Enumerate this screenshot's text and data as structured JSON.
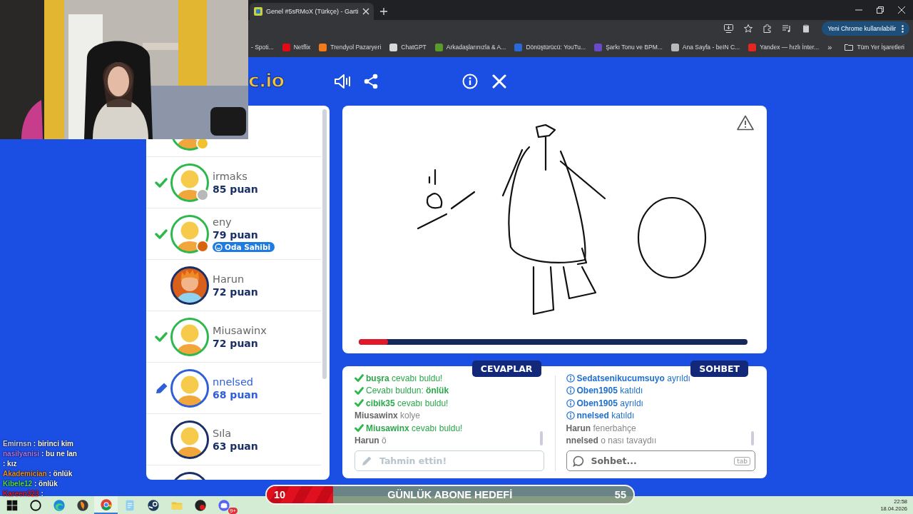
{
  "browser": {
    "tab": {
      "title": "Genel #5sRMoX (Türkçe) - Garti",
      "selected": true
    },
    "update_button": "Yeni Chrome kullanılabilir",
    "bookmarks": [
      {
        "label": "- Spoti..."
      },
      {
        "label": "Netflix",
        "color": "#e50914"
      },
      {
        "label": "Trendyol Pazaryeri",
        "color": "#f27a1a"
      },
      {
        "label": "ChatGPT",
        "color": "#d8d8d8"
      },
      {
        "label": "Arkadaşlarınızla & A...",
        "color": "#5a9a2a"
      },
      {
        "label": "Dönüştürücü: YouTu...",
        "color": "#2a6ad8"
      },
      {
        "label": "Şarkı Tonu ve BPM...",
        "color": "#6a4ac8"
      },
      {
        "label": "Ana Sayfa - beIN C...",
        "color": "#b8b8b8"
      },
      {
        "label": "Yandex — hızlı İnter...",
        "color": "#e52620"
      }
    ],
    "more_bookmarks": "»",
    "all_bookmarks": "Tüm Yer İşaretleri"
  },
  "game": {
    "logo": "c.io",
    "players": [
      {
        "guessed": true,
        "drawing": false,
        "kind": "plain",
        "color": "#f2c12e"
      },
      {
        "name": "irmaks",
        "score": "85 puan",
        "guessed": true,
        "drawing": false,
        "kind": "plain",
        "color": "#b8b8b8"
      },
      {
        "name": "eny",
        "score": "79 puan",
        "guessed": true,
        "drawing": false,
        "kind": "plain",
        "color": "#d8640e",
        "badge": "Oda Sahibi"
      },
      {
        "name": "Harun",
        "score": "72 puan",
        "guessed": false,
        "drawing": false,
        "kind": "spiky"
      },
      {
        "name": "Miusawinx",
        "score": "72 puan",
        "guessed": true,
        "drawing": false,
        "kind": "plain"
      },
      {
        "name": "nnelsed",
        "score": "68 puan",
        "guessed": false,
        "drawing": true,
        "kind": "plain"
      },
      {
        "name": "Sıla",
        "score": "63 puan",
        "guessed": false,
        "drawing": false,
        "kind": "plain"
      },
      {
        "guessed": false,
        "drawing": false,
        "kind": "plain"
      }
    ],
    "canvas": {
      "progress": {
        "level": 0.075
      }
    },
    "answers": {
      "title": "CEVAPLAR",
      "messages": [
        {
          "kind": "found",
          "name": "buşra",
          "text": "cevabı buldu!"
        },
        {
          "kind": "you_found",
          "text": "Cevabı buldun: **önlük**"
        },
        {
          "kind": "found",
          "name": "cibik35",
          "text": "cevabı buldu!"
        },
        {
          "kind": "guess",
          "name": "Miusawinx",
          "text": "kolye"
        },
        {
          "kind": "found",
          "name": "Miusawinx",
          "text": "cevabı buldu!"
        },
        {
          "kind": "guess",
          "name": "Harun",
          "text": "ö"
        }
      ],
      "input": {
        "placeholder": "Tahmin ettin!",
        "disabled": true
      }
    },
    "chat": {
      "title": "SOHBET",
      "messages": [
        {
          "kind": "info",
          "name": "Sedatsenikucumsuyo",
          "text": "ayrıldı"
        },
        {
          "kind": "info",
          "name": "Oben1905",
          "text": "katıldı"
        },
        {
          "kind": "info",
          "name": "Oben1905",
          "text": "ayrıldı"
        },
        {
          "kind": "info",
          "name": "nnelsed",
          "text": "katıldı"
        },
        {
          "kind": "guess",
          "name": "Harun",
          "text": "fenerbahçe"
        },
        {
          "kind": "guess",
          "name": "nnelsed",
          "text": "o nası tavaydıı"
        }
      ],
      "input": {
        "placeholder": "Sohbet...",
        "key_hint": "tab",
        "disabled": false
      }
    }
  },
  "stream_chat": [
    {
      "name": "Emirnsn",
      "text": ": birinci kim",
      "color": "#d0d6ff"
    },
    {
      "name": "nasilyanisi",
      "text": ": bu ne lan",
      "color": "#b07cff"
    },
    {
      "text": ": kız"
    },
    {
      "name": "Akademician",
      "text": ": önlük",
      "color": "#e8902a"
    },
    {
      "name": "Kibele12",
      "text": ": önlük",
      "color": "#4ee04e"
    },
    {
      "name": "Kareen323",
      "text": ":",
      "color": "#e02030"
    }
  ],
  "sub_goal": {
    "title": "GÜNLÜK ABONE HEDEFİ",
    "current": "10",
    "target": "55",
    "level": 0.18
  },
  "taskbar": {
    "apps": [
      {
        "kind": "windows",
        "selected": false
      },
      {
        "kind": "search",
        "selected": false
      },
      {
        "kind": "edge",
        "selected": false
      },
      {
        "kind": "studio",
        "selected": false
      },
      {
        "kind": "chrome",
        "selected": true
      },
      {
        "kind": "notepad",
        "selected": false
      },
      {
        "kind": "steam",
        "selected": false
      },
      {
        "kind": "folder",
        "selected": false
      },
      {
        "kind": "recorder",
        "selected": false
      },
      {
        "kind": "discord",
        "selected": false,
        "badge": "9+"
      }
    ],
    "time": "22:58",
    "date": "18.04.2026"
  }
}
